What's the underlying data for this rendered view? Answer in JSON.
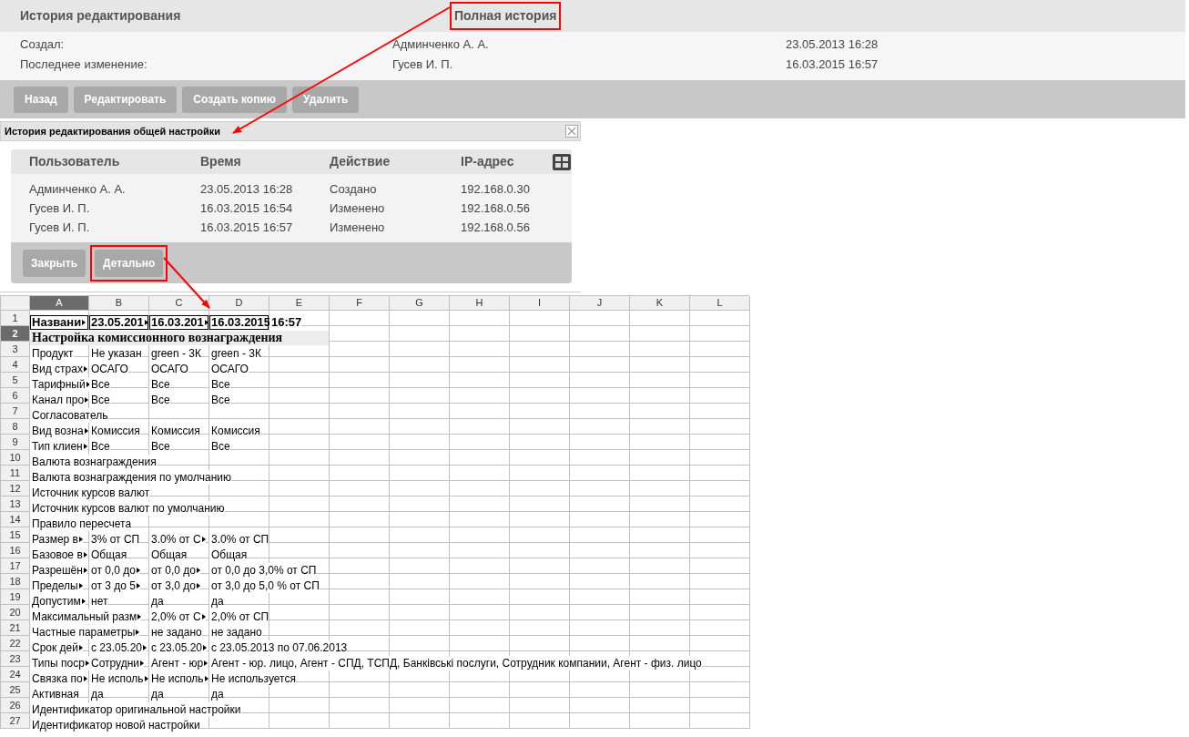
{
  "header": {
    "title": "История редактирования",
    "full_history_link": {
      "label": "Полная история",
      "highlighted": true
    }
  },
  "info": [
    {
      "label": "Создал:",
      "user": "Админченко А. А.",
      "time": "23.05.2013 16:28"
    },
    {
      "label": "Последнее изменение:",
      "user": "Гусев И. П.",
      "time": "16.03.2015 16:57"
    }
  ],
  "buttons": [
    "Назад",
    "Редактировать",
    "Создать копию",
    "Удалить"
  ],
  "dialog": {
    "title": "История редактирования общей настройки",
    "columns": [
      "Пользователь",
      "Время",
      "Действие",
      "IP-адрес"
    ],
    "rows": [
      [
        "Админченко А. А.",
        "23.05.2013 16:28",
        "Создано",
        "192.168.0.30"
      ],
      [
        "Гусев И. П.",
        "16.03.2015 16:54",
        "Изменено",
        "192.168.0.56"
      ],
      [
        "Гусев И. П.",
        "16.03.2015 16:57",
        "Изменено",
        "192.168.0.56"
      ]
    ],
    "buttons": [
      {
        "label": "Закрыть",
        "highlighted": false
      },
      {
        "label": "Детально",
        "highlighted": true
      }
    ]
  },
  "sheet": {
    "columns": [
      {
        "label": "A",
        "selected": true
      },
      {
        "label": "B",
        "selected": false
      },
      {
        "label": "C",
        "selected": false
      },
      {
        "label": "D",
        "selected": false
      },
      {
        "label": "E",
        "selected": false
      },
      {
        "label": "F",
        "selected": false
      },
      {
        "label": "G",
        "selected": false
      },
      {
        "label": "H",
        "selected": false
      },
      {
        "label": "I",
        "selected": false
      },
      {
        "label": "J",
        "selected": false
      },
      {
        "label": "K",
        "selected": false
      },
      {
        "label": "L",
        "selected": false
      }
    ],
    "rows": [
      {
        "number": "1",
        "selected": false,
        "kind": "boxed",
        "cells": [
          {
            "text": "Названи",
            "overflow": true
          },
          {
            "text": "23.05.201",
            "overflow": true
          },
          {
            "text": "16.03.201",
            "overflow": true
          },
          {
            "text": "16.03.2015",
            "overflow": false
          },
          {
            "text": "16:57",
            "overflow": false
          }
        ]
      },
      {
        "number": "2",
        "selected": true,
        "kind": "title",
        "cells": [
          {
            "text": "Настройка комиссионного вознаграждения",
            "overflow": false
          }
        ]
      },
      {
        "number": "3",
        "selected": false,
        "kind": "plain",
        "cells": [
          {
            "text": "Продукт",
            "overflow": false
          },
          {
            "text": "Не указан",
            "overflow": false
          },
          {
            "text": "green - 3К",
            "overflow": false
          },
          {
            "text": "green - 3К",
            "overflow": false
          }
        ]
      },
      {
        "number": "4",
        "selected": false,
        "kind": "plain",
        "cells": [
          {
            "text": "Вид страх",
            "overflow": true
          },
          {
            "text": "ОСАГО",
            "overflow": false
          },
          {
            "text": "ОСАГО",
            "overflow": false
          },
          {
            "text": "ОСАГО",
            "overflow": false
          }
        ]
      },
      {
        "number": "5",
        "selected": false,
        "kind": "plain",
        "cells": [
          {
            "text": "Тарифный",
            "overflow": true
          },
          {
            "text": "Все",
            "overflow": false
          },
          {
            "text": "Все",
            "overflow": false
          },
          {
            "text": "Все",
            "overflow": false
          }
        ]
      },
      {
        "number": "6",
        "selected": false,
        "kind": "plain",
        "cells": [
          {
            "text": "Канал про",
            "overflow": true
          },
          {
            "text": "Все",
            "overflow": false
          },
          {
            "text": "Все",
            "overflow": false
          },
          {
            "text": "Все",
            "overflow": false
          }
        ]
      },
      {
        "number": "7",
        "selected": false,
        "kind": "plain",
        "cells": [
          {
            "text": "Согласователь",
            "overflow": false
          }
        ]
      },
      {
        "number": "8",
        "selected": false,
        "kind": "plain",
        "cells": [
          {
            "text": "Вид возна",
            "overflow": true
          },
          {
            "text": "Комиссия",
            "overflow": false
          },
          {
            "text": "Комиссия",
            "overflow": false
          },
          {
            "text": "Комиссия",
            "overflow": false
          }
        ]
      },
      {
        "number": "9",
        "selected": false,
        "kind": "plain",
        "cells": [
          {
            "text": "Тип клиен",
            "overflow": true
          },
          {
            "text": "Все",
            "overflow": false
          },
          {
            "text": "Все",
            "overflow": false
          },
          {
            "text": "Все",
            "overflow": false
          }
        ]
      },
      {
        "number": "10",
        "selected": false,
        "kind": "plain",
        "cells": [
          {
            "text": "Валюта вознаграждения",
            "overflow": false
          }
        ]
      },
      {
        "number": "11",
        "selected": false,
        "kind": "plain",
        "cells": [
          {
            "text": "Валюта вознаграждения по умолчанию",
            "overflow": false
          }
        ]
      },
      {
        "number": "12",
        "selected": false,
        "kind": "plain",
        "cells": [
          {
            "text": "Источник курсов валют",
            "overflow": false
          }
        ]
      },
      {
        "number": "13",
        "selected": false,
        "kind": "plain",
        "cells": [
          {
            "text": "Источник курсов валют по умолчанию",
            "overflow": false
          }
        ]
      },
      {
        "number": "14",
        "selected": false,
        "kind": "plain",
        "cells": [
          {
            "text": "Правило пересчета",
            "overflow": false
          }
        ]
      },
      {
        "number": "15",
        "selected": false,
        "kind": "plain",
        "cells": [
          {
            "text": "Размер в",
            "overflow": true
          },
          {
            "text": "3% от СП",
            "overflow": false
          },
          {
            "text": "3.0% от С",
            "overflow": true
          },
          {
            "text": "3.0% от СП",
            "overflow": false
          }
        ]
      },
      {
        "number": "16",
        "selected": false,
        "kind": "plain",
        "cells": [
          {
            "text": "Базовое в",
            "overflow": true
          },
          {
            "text": "Общая",
            "overflow": false
          },
          {
            "text": "Общая",
            "overflow": false
          },
          {
            "text": "Общая",
            "overflow": false
          }
        ]
      },
      {
        "number": "17",
        "selected": false,
        "kind": "plain",
        "cells": [
          {
            "text": "Разрешён",
            "overflow": true
          },
          {
            "text": "от 0,0 до",
            "overflow": true
          },
          {
            "text": "от 0,0 до",
            "overflow": true
          },
          {
            "text": "от 0,0 до 3,0% от СП",
            "overflow": false
          }
        ]
      },
      {
        "number": "18",
        "selected": false,
        "kind": "plain",
        "cells": [
          {
            "text": "Пределы",
            "overflow": true
          },
          {
            "text": "от 3 до 5",
            "overflow": true
          },
          {
            "text": "от 3,0 до",
            "overflow": true
          },
          {
            "text": "от 3,0 до 5,0 % от СП",
            "overflow": false
          }
        ]
      },
      {
        "number": "19",
        "selected": false,
        "kind": "plain",
        "cells": [
          {
            "text": "Допустим",
            "overflow": true
          },
          {
            "text": "нет",
            "overflow": false
          },
          {
            "text": "да",
            "overflow": false
          },
          {
            "text": "да",
            "overflow": false
          }
        ]
      },
      {
        "number": "20",
        "selected": false,
        "kind": "plain",
        "cells": [
          {
            "text": "Максимальный разм",
            "overflow": true
          },
          null,
          {
            "text": "2,0% от С",
            "overflow": true
          },
          {
            "text": "2,0% от СП",
            "overflow": false
          }
        ]
      },
      {
        "number": "21",
        "selected": false,
        "kind": "plain",
        "cells": [
          {
            "text": "Частные параметры",
            "overflow": true
          },
          null,
          {
            "text": "не задано",
            "overflow": false
          },
          {
            "text": "не задано",
            "overflow": false
          }
        ]
      },
      {
        "number": "22",
        "selected": false,
        "kind": "plain",
        "cells": [
          {
            "text": "Срок дей",
            "overflow": true
          },
          {
            "text": "с 23.05.20",
            "overflow": true
          },
          {
            "text": "с 23.05.20",
            "overflow": true
          },
          {
            "text": "с 23.05.2013 по 07.06.2013",
            "overflow": false
          }
        ]
      },
      {
        "number": "23",
        "selected": false,
        "kind": "plain",
        "cells": [
          {
            "text": "Типы поср",
            "overflow": true
          },
          {
            "text": "Сотрудни",
            "overflow": true
          },
          {
            "text": "Агент - юр",
            "overflow": true
          },
          {
            "text": "Агент - юр. лицо, Агент - СПД, ТСПД, Банківські послуги, Сотрудник компании, Агент - физ. лицо",
            "overflow": false
          }
        ]
      },
      {
        "number": "24",
        "selected": false,
        "kind": "plain",
        "cells": [
          {
            "text": "Связка по",
            "overflow": true
          },
          {
            "text": "Не исполь",
            "overflow": true
          },
          {
            "text": "Не исполь",
            "overflow": true
          },
          {
            "text": "Не используется",
            "overflow": false
          }
        ]
      },
      {
        "number": "25",
        "selected": false,
        "kind": "plain",
        "cells": [
          {
            "text": "Активная",
            "overflow": false
          },
          {
            "text": "да",
            "overflow": false
          },
          {
            "text": "да",
            "overflow": false
          },
          {
            "text": "да",
            "overflow": false
          }
        ]
      },
      {
        "number": "26",
        "selected": false,
        "kind": "plain",
        "cells": [
          {
            "text": "Идентификатор оригинальной настройки",
            "overflow": false
          }
        ]
      },
      {
        "number": "27",
        "selected": false,
        "kind": "plain",
        "cells": [
          {
            "text": "Идентификатор новой настройки",
            "overflow": false
          }
        ]
      }
    ]
  }
}
